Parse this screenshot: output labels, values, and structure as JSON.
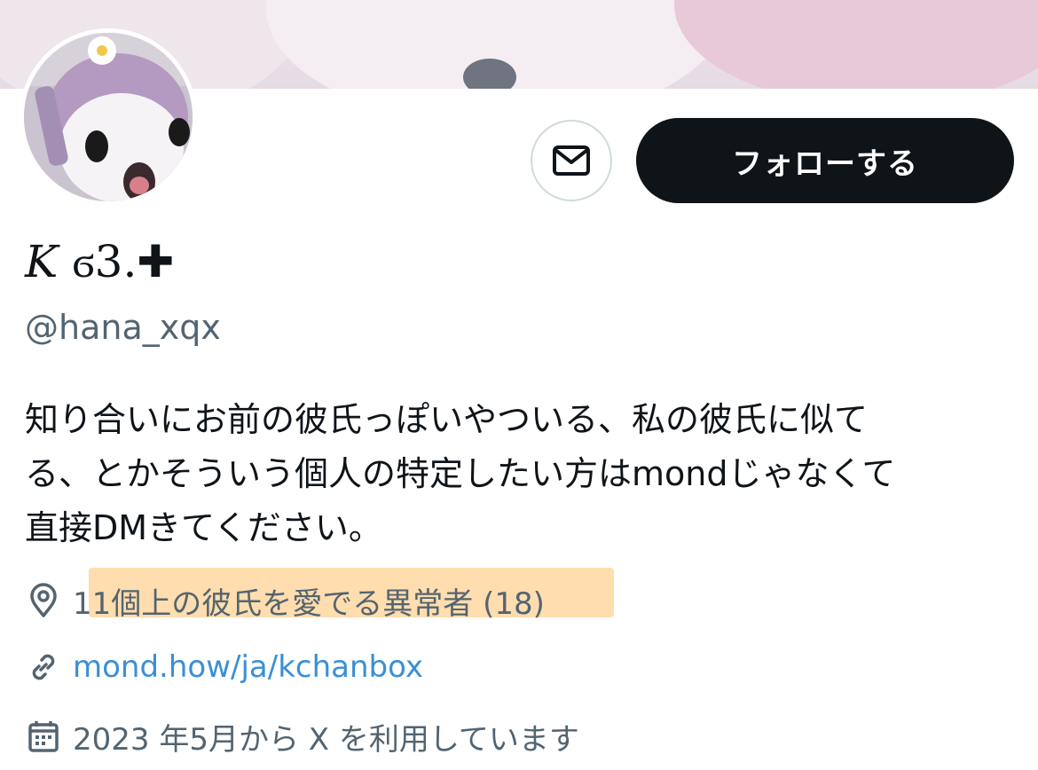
{
  "profile": {
    "display_name": "K Ộ3.✚",
    "display_name_shown": "𝐾 ϭ3.✚",
    "handle": "@hana_xqx",
    "bio_lines": [
      "知り合いにお前の彼氏っぽいやついる、私の彼氏に似て",
      "る、とかそういう個人の特定したい方はmondじゃなくて",
      "直接DMきてください。"
    ],
    "location": "11個上の彼氏を愛でる異常者 (18)",
    "website": "mond.how/ja/kchanbox",
    "joined": "2023 年5月から X を利用しています"
  },
  "actions": {
    "follow_label": "フォローする"
  },
  "icons": {
    "dm": "mail-icon",
    "location": "location-pin-icon",
    "link": "link-icon",
    "joined": "calendar-icon"
  },
  "colors": {
    "follow_bg": "#0f1419",
    "secondary_text": "#536471",
    "link": "#3a8fd6",
    "highlight": "#ffd7a0"
  }
}
